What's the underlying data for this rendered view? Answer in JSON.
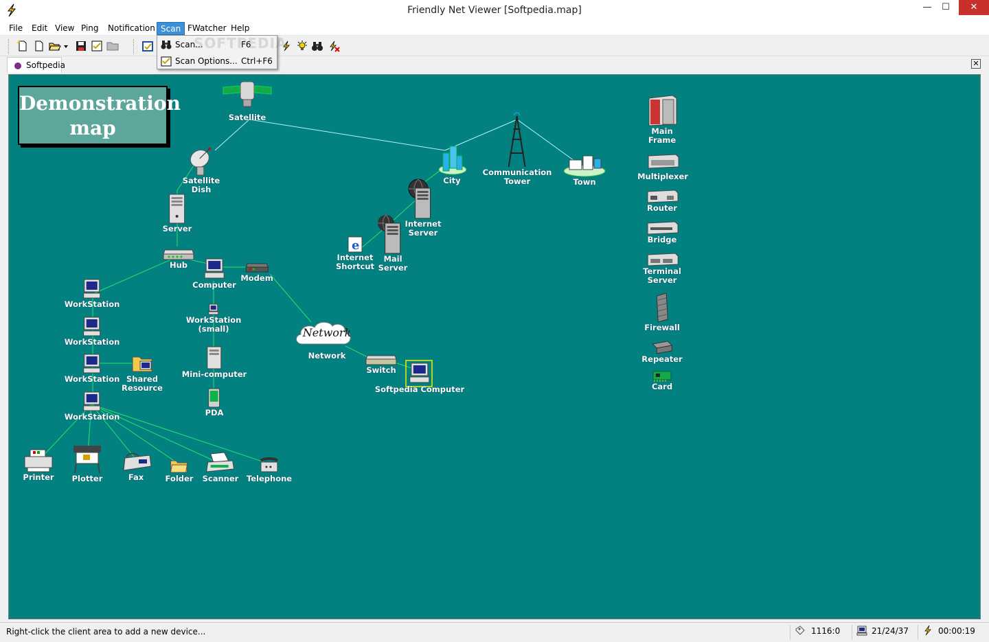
{
  "window": {
    "title": "Friendly Net Viewer [Softpedia.map]",
    "min": "—",
    "max": "☐",
    "close": "✕"
  },
  "menu": [
    "File",
    "Edit",
    "View",
    "Ping",
    "Notification",
    "Scan",
    "FWatcher",
    "Help"
  ],
  "scan_menu": {
    "items": [
      {
        "label": "Scan...",
        "shortcut": "F6",
        "icon": "binoculars-icon"
      },
      {
        "label": "Scan Options...",
        "shortcut": "Ctrl+F6",
        "icon": "options-icon"
      }
    ]
  },
  "watermark": "SOFTPEDIA",
  "tab": {
    "label": "Softpedia",
    "close": "✕"
  },
  "map": {
    "title": "Demonstration\nmap",
    "background_color": "#008080",
    "network_cloud_text": "Network",
    "devices": {
      "satellite": "Satellite",
      "satellite_dish": "Satellite\nDish",
      "server": "Server",
      "hub": "Hub",
      "computer": "Computer",
      "modem": "Modem",
      "ws1": "WorkStation",
      "ws2": "WorkStation",
      "ws3": "WorkStation",
      "ws4": "WorkStation",
      "ws_small": "WorkStation\n(small)",
      "shared_resource": "Shared\nResource",
      "mini_computer": "Mini-computer",
      "pda": "PDA",
      "printer": "Printer",
      "plotter": "Plotter",
      "fax": "Fax",
      "folder": "Folder",
      "scanner": "Scanner",
      "telephone": "Telephone",
      "network": "Network",
      "switch": "Switch",
      "softpedia_computer": "Softpedia Computer",
      "city": "City",
      "communication_tower": "Communication\nTower",
      "town": "Town",
      "internet_server": "Internet\nServer",
      "internet_shortcut": "Internet\nShortcut",
      "mail_server": "Mail\nServer",
      "main_frame": "Main\nFrame",
      "multiplexer": "Multiplexer",
      "router": "Router",
      "bridge": "Bridge",
      "terminal_server": "Terminal\nServer",
      "firewall": "Firewall",
      "repeater": "Repeater",
      "card": "Card"
    }
  },
  "status": {
    "message": "Right-click the client area to add a new device...",
    "counter": "1116:0",
    "devices": "21/24/37",
    "time": "00:00:19"
  }
}
